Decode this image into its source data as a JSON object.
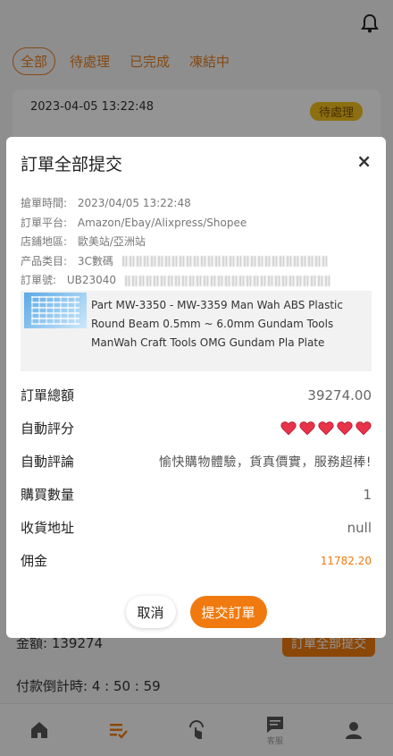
{
  "tabs": [
    {
      "label": "全部"
    },
    {
      "label": "待處理"
    },
    {
      "label": "已完成"
    },
    {
      "label": "凍結中"
    }
  ],
  "order_card": {
    "time": "2023-04-05 13:22:48",
    "status": "待處理"
  },
  "bottom": {
    "amount": "金額: 139274",
    "submit_all": "訂單全部提交",
    "countdown": "付款倒計時: 4 : 50 : 59"
  },
  "nav": [
    {
      "icon": "home-icon",
      "label": ""
    },
    {
      "icon": "orders-icon",
      "label": ""
    },
    {
      "icon": "tap-icon",
      "label": ""
    },
    {
      "icon": "message-icon",
      "label": "客服"
    },
    {
      "icon": "user-icon",
      "label": ""
    }
  ],
  "modal": {
    "title": "訂單全部提交",
    "close": "×",
    "info": {
      "grab_time_label": "搶單時間:",
      "grab_time": "2023/04/05 13:22:48",
      "platform_label": "訂單平台:",
      "platform": "Amazon/Ebay/Alixpress/Shopee",
      "region_label": "店鋪地區:",
      "region": "歐美站/亞洲站",
      "category_label": "产品类目:",
      "category": "3C數碼",
      "order_no_label": "訂單號:",
      "order_no": "UB23040"
    },
    "product_name": "Part MW-3350 - MW-3359 Man Wah ABS Plastic Round Beam 0.5mm ~ 6.0mm Gundam Tools ManWah Craft Tools OMG Gundam Pla Plate",
    "details": {
      "total_label": "訂單總額",
      "total": "39274.00",
      "rating_label": "自動評分",
      "rating": 5,
      "comment_label": "自動評論",
      "comment": "愉快購物體驗，貨真價實，服務超棒!",
      "qty_label": "購買數量",
      "qty": "1",
      "address_label": "收貨地址",
      "address": "null",
      "commission_label": "佣金",
      "commission": "11782.20"
    },
    "cancel": "取消",
    "submit": "提交訂單"
  },
  "colors": {
    "accent": "#f07a0f",
    "heart": "#e8334a",
    "badge": "#f2c01e"
  }
}
